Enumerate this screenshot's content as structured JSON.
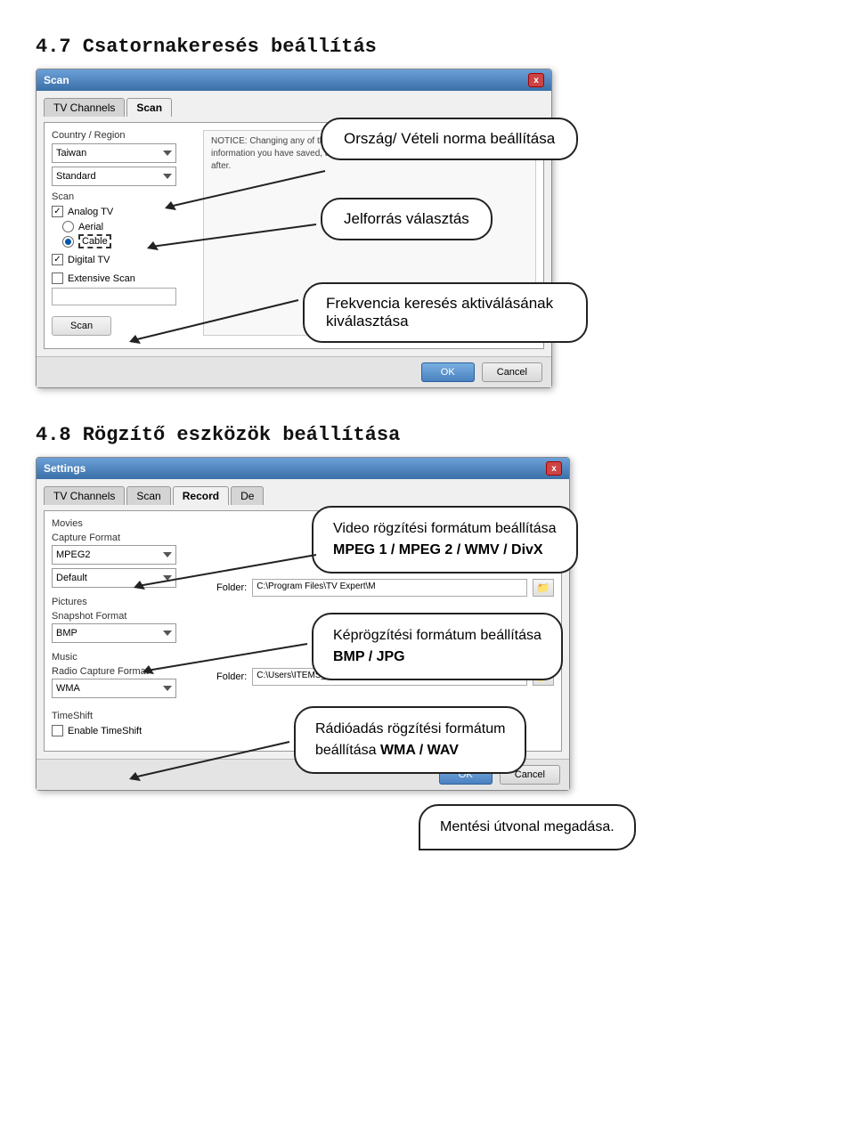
{
  "section1": {
    "heading": "4.7   Csatornakeresés beállítás",
    "dialog": {
      "title": "Scan",
      "close": "x",
      "tabs": [
        "TV Channels",
        "Scan"
      ],
      "active_tab": "Scan",
      "country_label": "Country / Region",
      "country_value": "Taiwan",
      "standard_value": "Standard",
      "notice": "NOTICE: Changing any of the settings on this page will erase all channel information you have saved, and if you change back to the initial state shortly after.",
      "scan_label": "Scan",
      "analog_tv_label": "Analog TV",
      "analog_tv_checked": true,
      "aerial_label": "Aerial",
      "aerial_checked": false,
      "cable_label": "Cable",
      "cable_checked": true,
      "digital_tv_label": "Digital TV",
      "digital_tv_checked": true,
      "extensive_scan_label": "Extensive Scan",
      "extensive_scan_checked": false,
      "scan_btn": "Scan",
      "ok_btn": "OK",
      "cancel_btn": "Cancel"
    },
    "callouts": [
      {
        "id": "callout1",
        "text": "Ország/ Vételi norma beállítása"
      },
      {
        "id": "callout2",
        "text": "Jelforrás választás"
      },
      {
        "id": "callout3",
        "text": "Frekvencia keresés aktiválásának kiválasztása"
      }
    ]
  },
  "section2": {
    "heading": "4.8   Rögzítő eszközök beállítása",
    "dialog": {
      "title": "Settings",
      "close": "x",
      "tabs": [
        "TV Channels",
        "Scan",
        "Record",
        "De"
      ],
      "active_tab": "Record",
      "movies_label": "Movies",
      "capture_format_label": "Capture Format",
      "capture_format_value": "MPEG2",
      "quality_value": "Default",
      "pictures_label": "Pictures",
      "snapshot_format_label": "Snapshot Format",
      "snapshot_format_value": "BMP",
      "music_label": "Music",
      "radio_capture_label": "Radio Capture Format",
      "radio_capture_value": "WMA",
      "folder_label": "Folder:",
      "movie_folder": "C:\\Program Files\\TV Expert\\M",
      "timeshift_label": "TimeShift",
      "enable_timeshift_label": "Enable TimeShift",
      "timeshift_folder": "C:\\Users\\ITEMS_~1\\AppDat",
      "ok_btn": "OK",
      "cancel_btn": "Cancel"
    },
    "callouts": [
      {
        "id": "callout4",
        "text": "Video rögzítési formátum beállítása\nMPEG 1 / MPEG 2 / WMV / DivX",
        "bold_part": "MPEG 1 / MPEG 2 / WMV / DivX"
      },
      {
        "id": "callout5",
        "text": "Képrögzítési formátum beállítása\nBMP / JPG",
        "bold_part": "BMP / JPG"
      },
      {
        "id": "callout6",
        "text": "Rádióadás rögzítési formátum beállítása WMA / WAV",
        "bold_part": "WMA / WAV"
      },
      {
        "id": "callout7",
        "text": "Mentési útvonal megadása."
      }
    ]
  }
}
